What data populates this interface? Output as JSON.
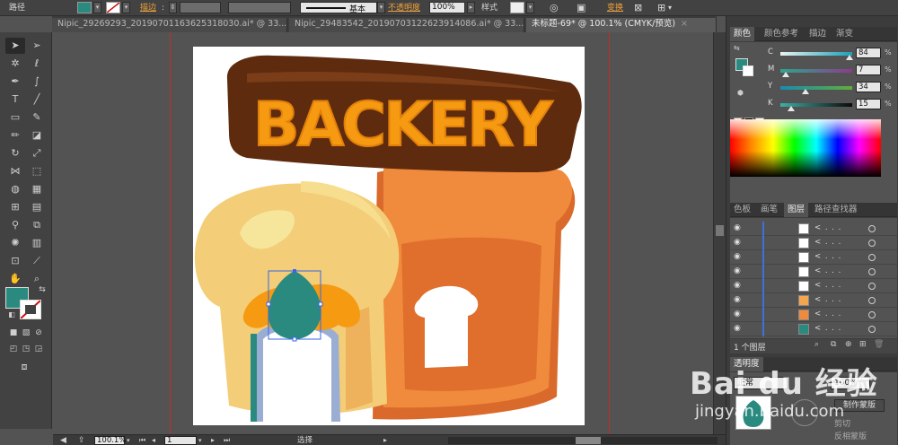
{
  "app": {
    "control_bar": {
      "selection_type": "路径",
      "stroke_label": "描边",
      "stroke_style": "基本",
      "opacity_label": "不透明度",
      "opacity_value": "100%",
      "style_label": "样式",
      "transform_label": "变换",
      "fill_color": "#2a8a80"
    },
    "tabs": [
      {
        "label": "Nipic_29269293_20190701163625318030.ai* @ 33..."
      },
      {
        "label": "Nipic_29483542_20190703122623914086.ai* @ 33..."
      },
      {
        "label": "未标题-69* @ 100.1% (CMYK/预览)"
      }
    ],
    "status": {
      "zoom": "100.1%",
      "page": "1",
      "mode": "选择"
    }
  },
  "artwork": {
    "title_text": "BACKERY",
    "colors": {
      "sign_brown": "#5e2b0f",
      "letters": "#f59a11",
      "bread_left": "#f3cd77",
      "bread_right": "#f08a3c",
      "teal": "#2a8a80"
    }
  },
  "panels": {
    "color": {
      "tabs": [
        "颜色",
        "颜色参考",
        "描边",
        "渐变"
      ],
      "rows": [
        {
          "label": "C",
          "value": "84",
          "unit": "%",
          "knob": 0.84
        },
        {
          "label": "M",
          "value": "7",
          "unit": "%",
          "knob": 0.07
        },
        {
          "label": "Y",
          "value": "34",
          "unit": "%",
          "knob": 0.34
        },
        {
          "label": "K",
          "value": "15",
          "unit": "%",
          "knob": 0.15
        }
      ]
    },
    "layers": {
      "tabs": [
        "色板",
        "画笔",
        "图层",
        "路径查找器"
      ],
      "row_name": "< . . .",
      "footer": "1 个图层",
      "rows": 9
    },
    "transparency": {
      "title": "透明度",
      "mode": "正常",
      "opacity": "100%",
      "make_mask": "制作蒙版",
      "clip": "剪切",
      "invert": "反相蒙版"
    }
  },
  "watermark": {
    "logo": "Bai du 经验",
    "url": "jingyan.baidu.com"
  }
}
